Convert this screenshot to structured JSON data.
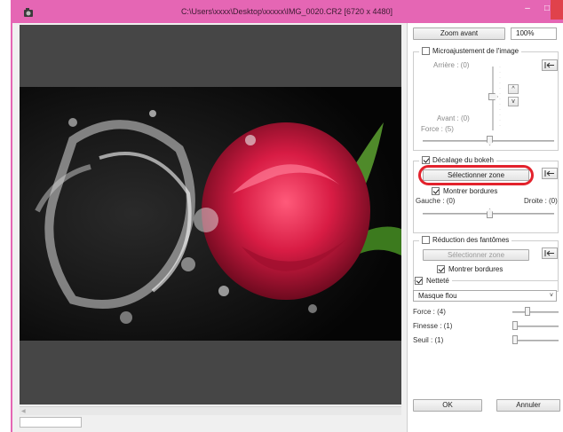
{
  "window": {
    "title": "C:\\Users\\xxxx\\Desktop\\xxxxx\\IMG_0020.CR2 [6720 x 4480]",
    "min_label": "–",
    "max_label": "□"
  },
  "toolbar": {
    "zoom_button": "Zoom avant",
    "zoom_level": "100%"
  },
  "micro": {
    "title": "Microajustement de l'image",
    "checked": false,
    "back_label": "Arrière : (0)",
    "front_label": "Avant : (0)",
    "force_label": "Force : (5)"
  },
  "bokeh": {
    "title": "Décalage du bokeh",
    "checked": true,
    "select_zone": "Sélectionner zone",
    "show_borders": "Montrer bordures",
    "left_label": "Gauche : (0)",
    "right_label": "Droite : (0)"
  },
  "ghost": {
    "title": "Réduction des fantômes",
    "checked": false,
    "select_zone": "Sélectionner zone",
    "show_borders": "Montrer bordures"
  },
  "sharpness": {
    "title": "Netteté",
    "checked": true,
    "mode": "Masque flou",
    "force_label": "Force : (4)",
    "fineness_label": "Finesse : (1)",
    "threshold_label": "Seuil : (1)"
  },
  "footer": {
    "ok": "OK",
    "cancel": "Annuler"
  },
  "colors": {
    "title_bar": "#e566b4",
    "close_button": "#e0424b",
    "highlight": "#e3222c"
  }
}
